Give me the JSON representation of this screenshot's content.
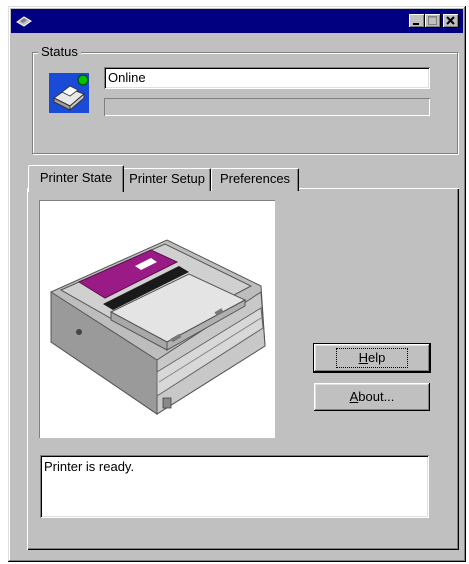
{
  "window": {
    "title": "",
    "controls": {
      "minimize": "minimize-icon",
      "maximize": "maximize-icon",
      "close": "close-icon"
    }
  },
  "status_group": {
    "legend": "Status",
    "status_text": "Online",
    "progress": 0,
    "icon": "printer-online-icon",
    "online_color": "#00c000"
  },
  "tabs": [
    {
      "label": "Printer State",
      "active": true
    },
    {
      "label": "Printer Setup",
      "active": false
    },
    {
      "label": "Preferences",
      "active": false
    }
  ],
  "printer_state": {
    "image": "laser-printer-image",
    "buttons": {
      "help": "Help",
      "about": "About..."
    },
    "message": "Printer is ready."
  },
  "colors": {
    "face": "#c0c0c0",
    "titlebar": "#000080",
    "accent": "#9b1b86"
  }
}
